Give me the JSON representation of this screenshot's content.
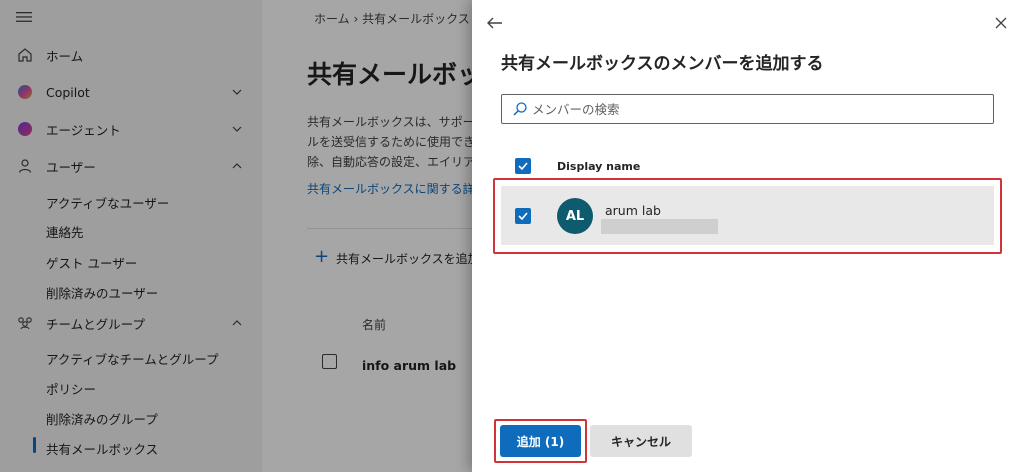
{
  "nav": {
    "menu_icon": "hamburger-icon",
    "items": [
      {
        "label": "ホーム",
        "icon": "home-icon"
      },
      {
        "label": "Copilot",
        "icon": "copilot-icon"
      },
      {
        "label": "エージェント",
        "icon": "agent-icon"
      },
      {
        "label": "ユーザー",
        "icon": "person-icon"
      },
      {
        "label": "チームとグループ",
        "icon": "people-team-icon"
      }
    ],
    "user_sub": [
      "アクティブなユーザー",
      "連絡先",
      "ゲスト ユーザー",
      "削除済みのユーザー"
    ],
    "team_sub": [
      "アクティブなチームとグループ",
      "ポリシー",
      "削除済みのグループ",
      "共有メールボックス"
    ]
  },
  "main": {
    "breadcrumb": "ホーム  ›  共有メールボックス",
    "title": "共有メールボックス",
    "desc_lines": [
      "共有メールボックスは、サポートや営業などのチームがメー",
      "ルを送受信するために使用できるメールボックスです。",
      "除、自動応答の設定、エイリアスの追加などを管理します。"
    ],
    "learn_link": "共有メールボックスに関する詳細",
    "add_command": "共有メールボックスを追加",
    "column_name": "名前",
    "rows": [
      {
        "name": "info arum lab"
      }
    ]
  },
  "panel": {
    "title": "共有メールボックスのメンバーを追加する",
    "search_placeholder": "メンバーの検索",
    "column_header": "Display name",
    "members": [
      {
        "initials": "AL",
        "name": "arum lab"
      }
    ],
    "add_button": "追加 (1)",
    "cancel_button": "キャンセル"
  },
  "colors": {
    "accent": "#0f6cbd",
    "avatar": "#0e5a6e",
    "highlight": "#d13438"
  }
}
